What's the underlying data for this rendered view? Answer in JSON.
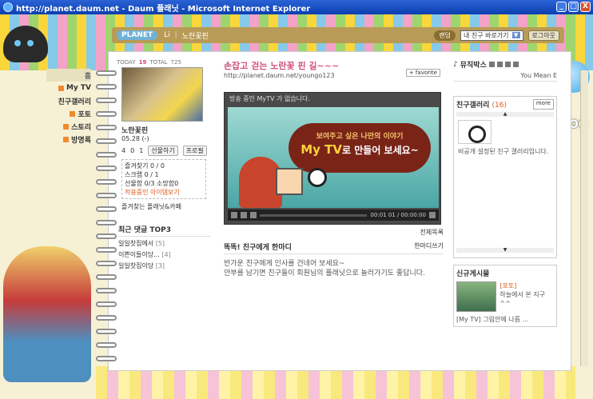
{
  "window": {
    "title": "http://planet.daum.net - Daum 플래닛 - Microsoft Internet Explorer",
    "buttons": [
      "_",
      "□",
      "X"
    ]
  },
  "topbar": {
    "brand": "PLANET",
    "menu": [
      "Li",
      "노란꽃핀"
    ],
    "random_label": "랜덤",
    "friend_select": "내 친구 바로가기",
    "logout_label": "로그아웃"
  },
  "nav": {
    "items": [
      {
        "label": "홈",
        "active": true
      },
      {
        "label": "My TV"
      },
      {
        "label": "친구갤러리"
      },
      {
        "label": "포토"
      },
      {
        "label": "스토리"
      },
      {
        "label": "방명록"
      }
    ]
  },
  "profile": {
    "today_label": "TODAY",
    "today_value": "19",
    "total_label": "TOTAL",
    "total_value": "725",
    "name": "노란꽃핀",
    "date": "05.28 (-)",
    "stats": [
      "4",
      "0",
      "1"
    ],
    "friend_btn": "선물하기",
    "profile_btn": "프로필",
    "box_lines": [
      "즐겨찾기 0 / 0",
      "스크랩 0 / 1",
      "선물함 0/3 소망함0"
    ],
    "box_highlight": "적용중인 아이템보기",
    "footer": "즐겨찾는 플래닛&카페"
  },
  "recent_comments": {
    "title": "최근 댓글 TOP3",
    "items": [
      {
        "text": "일일찻집에서",
        "count": "[5]"
      },
      {
        "text": "이쁜이들이당...",
        "count": "[4]"
      },
      {
        "text": "일일찻집이당",
        "count": "[3]"
      }
    ]
  },
  "main": {
    "title": "손잡고 걷는 노란꽃 핀 길~~~",
    "url": "http://planet.daum.net/youngo123",
    "favorite_label": "+ favorite",
    "tv_header": "방송 중인 MyTV 가 없습니다.",
    "bubble_small": "보여주고 싶은 나만의 이야기",
    "bubble_big_bold": "My TV",
    "bubble_big_rest": "로 만들어 보세요~",
    "time": "00:01 01 / 00:00:00",
    "list_all": "전체목록",
    "msg_title": "똑똑! 친구에게 한마디",
    "msg_write": "한마디쓰기",
    "msg_body_1": "반가운 친구에게 인사를 건네어 보세요~",
    "msg_body_2": "안부를 남기면 친구들이 회원님의 플래닛으로 놀러가기도 좋답니다."
  },
  "music": {
    "title": "뮤직박스",
    "track": "You Mean E"
  },
  "gallery": {
    "title": "친구갤러리",
    "count": "(16)",
    "more": "more",
    "text": "비공개 설정된 친구 갤러리입니다."
  },
  "newpost": {
    "title": "신규게시물",
    "tag": "[포토]",
    "text": "하늘에서 본 지구 ^^",
    "footer": "[My TV] 그림안에 나름 ..."
  }
}
